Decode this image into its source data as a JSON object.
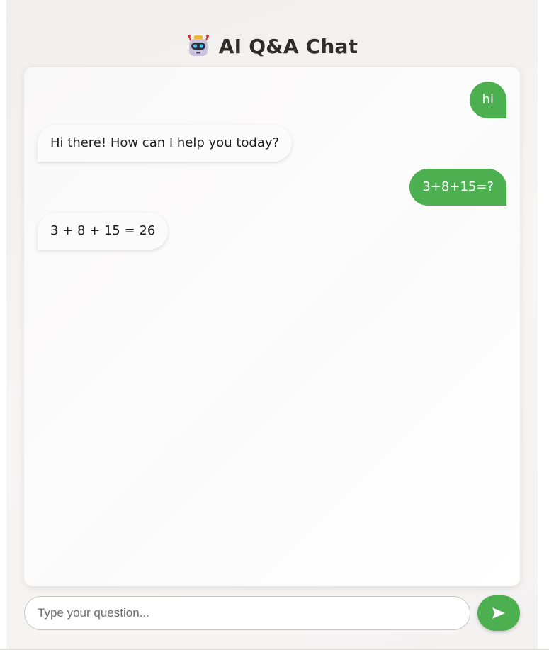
{
  "header": {
    "icon": "robot-icon",
    "title": "AI Q&A Chat"
  },
  "chat": {
    "messages": [
      {
        "role": "user",
        "text": "hi"
      },
      {
        "role": "bot",
        "text": "Hi there! How can I help you today?"
      },
      {
        "role": "user",
        "text": "3+8+15=?"
      },
      {
        "role": "bot",
        "text": "3 + 8 + 15 = 26"
      }
    ]
  },
  "input": {
    "placeholder": "Type your question...",
    "value": ""
  },
  "send": {
    "icon": "send-arrow-icon"
  },
  "colors": {
    "accent": "#4caf50",
    "bot_bubble": "#fbfbfb",
    "title_text": "#2d2d2d"
  }
}
